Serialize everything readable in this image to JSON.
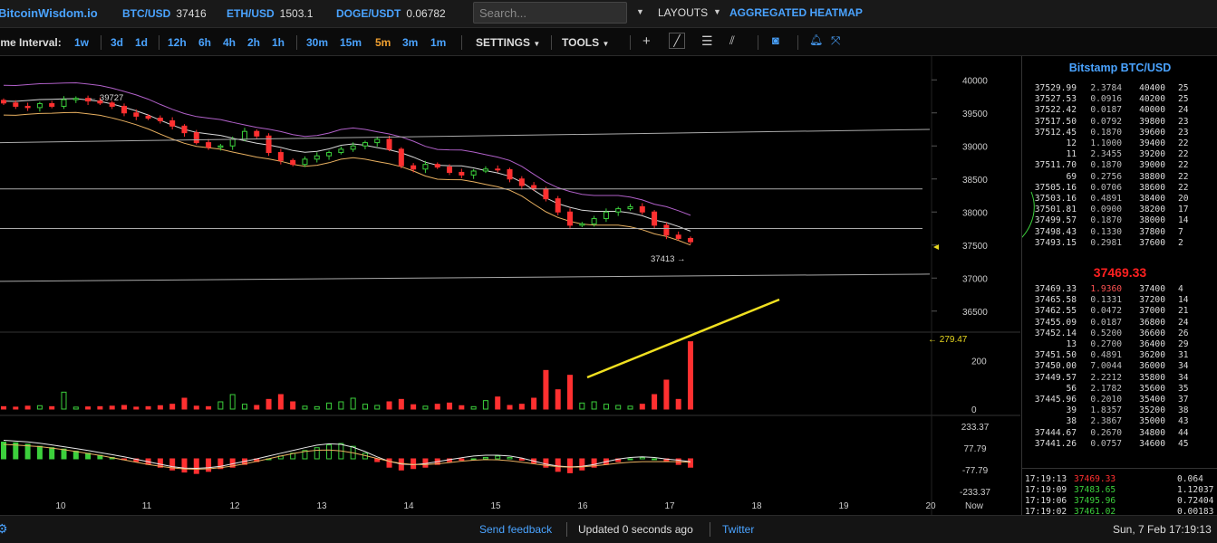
{
  "header": {
    "logo": "BitcoinWisdom.io",
    "tickers": [
      {
        "symbol": "BTC/USD",
        "value": "37416"
      },
      {
        "symbol": "ETH/USD",
        "value": "1503.1"
      },
      {
        "symbol": "DOGE/USDT",
        "value": "0.06782"
      }
    ],
    "search_placeholder": "Search...",
    "layouts_label": "LAYOUTS",
    "heatmap_label": "AGGREGATED HEATMAP"
  },
  "toolbar": {
    "interval_label": "ime Interval:",
    "intervals": [
      {
        "label": "1w",
        "active": false
      },
      {
        "label": "3d",
        "active": false
      },
      {
        "label": "1d",
        "active": false
      },
      {
        "label": "12h",
        "active": false
      },
      {
        "label": "6h",
        "active": false
      },
      {
        "label": "4h",
        "active": false
      },
      {
        "label": "2h",
        "active": false
      },
      {
        "label": "1h",
        "active": false
      },
      {
        "label": "30m",
        "active": false
      },
      {
        "label": "15m",
        "active": false
      },
      {
        "label": "5m",
        "active": true
      },
      {
        "label": "3m",
        "active": false
      },
      {
        "label": "1m",
        "active": false
      }
    ],
    "settings_label": "SETTINGS",
    "tools_label": "TOOLS",
    "icons": [
      "crosshair-icon",
      "line-tool-icon",
      "fib-tool-icon",
      "fan-tool-icon",
      "camera-icon",
      "bell-icon",
      "fullscreen-icon"
    ]
  },
  "chart_data": {
    "type": "candlestick",
    "price_axis": [
      "40000",
      "39500",
      "39000",
      "38500",
      "38000",
      "37500",
      "37000",
      "36500"
    ],
    "price_range": [
      36250,
      40250
    ],
    "high_label": "39727",
    "low_label": "37413",
    "x_labels": [
      "10",
      "11",
      "12",
      "13",
      "14",
      "15",
      "16",
      "17",
      "18",
      "19",
      "20",
      "Now"
    ],
    "volume_axis": [
      "200",
      "0"
    ],
    "volume_max_label": "279.47",
    "volume_range": [
      0,
      300
    ],
    "macd_axis": [
      "233.37",
      "77.79",
      "-77.79",
      "-233.37"
    ],
    "macd_range": [
      -260,
      260
    ],
    "close_series": [
      39650,
      39600,
      39580,
      39640,
      39600,
      39700,
      39720,
      39680,
      39650,
      39600,
      39500,
      39450,
      39420,
      39380,
      39300,
      39200,
      39050,
      38980,
      39000,
      39100,
      39220,
      39150,
      38900,
      38780,
      38720,
      38800,
      38850,
      38900,
      38950,
      39000,
      39050,
      39100,
      38950,
      38700,
      38650,
      38720,
      38680,
      38600,
      38560,
      38620,
      38650,
      38640,
      38500,
      38400,
      38350,
      38200,
      38000,
      37800,
      37820,
      37900,
      38000,
      38050,
      38080,
      38000,
      37800,
      37650,
      37600,
      37550
    ],
    "volume_series": [
      10,
      8,
      12,
      14,
      10,
      70,
      8,
      9,
      10,
      12,
      15,
      8,
      10,
      14,
      20,
      45,
      12,
      10,
      30,
      60,
      20,
      15,
      40,
      60,
      30,
      12,
      10,
      25,
      30,
      45,
      20,
      15,
      30,
      40,
      18,
      12,
      20,
      25,
      14,
      10,
      35,
      50,
      15,
      20,
      45,
      160,
      80,
      140,
      25,
      30,
      20,
      15,
      12,
      20,
      60,
      120,
      40,
      279
    ],
    "macd_series": [
      120,
      115,
      105,
      90,
      80,
      70,
      55,
      40,
      25,
      10,
      -5,
      -20,
      -40,
      -60,
      -80,
      -95,
      -105,
      -90,
      -70,
      -60,
      -40,
      -20,
      0,
      20,
      40,
      60,
      80,
      100,
      110,
      90,
      40,
      -20,
      -60,
      -80,
      -70,
      -60,
      -40,
      -20,
      -10,
      0,
      10,
      20,
      10,
      -10,
      -30,
      -60,
      -90,
      -100,
      -80,
      -60,
      -40,
      -20,
      0,
      10,
      0,
      -20,
      -40,
      -60
    ],
    "trend_lines": true,
    "bollinger_bands": true,
    "grid": false
  },
  "orderbook": {
    "title": "Bitstamp BTC/USD",
    "asks": [
      [
        "37529.99",
        "2.3784",
        "40400",
        "25"
      ],
      [
        "37527.53",
        "0.0916",
        "40200",
        "25"
      ],
      [
        "37522.42",
        "0.0187",
        "40000",
        "24"
      ],
      [
        "37517.50",
        "0.0792",
        "39800",
        "23"
      ],
      [
        "37512.45",
        "0.1870",
        "39600",
        "23"
      ],
      [
        "12",
        "1.1000",
        "39400",
        "22"
      ],
      [
        "11",
        "2.3455",
        "39200",
        "22"
      ],
      [
        "37511.70",
        "0.1870",
        "39000",
        "22"
      ],
      [
        "69",
        "0.2756",
        "38800",
        "22"
      ],
      [
        "37505.16",
        "0.0706",
        "38600",
        "22"
      ],
      [
        "37503.16",
        "0.4891",
        "38400",
        "20"
      ],
      [
        "37501.81",
        "0.0900",
        "38200",
        "17"
      ],
      [
        "37499.57",
        "0.1870",
        "38000",
        "14"
      ],
      [
        "37498.43",
        "0.1330",
        "37800",
        "7"
      ],
      [
        "37493.15",
        "0.2981",
        "37600",
        "2"
      ]
    ],
    "last_price": "37469.33",
    "bids": [
      [
        "37469.33",
        "1.9360",
        "37400",
        "4"
      ],
      [
        "37465.58",
        "0.1331",
        "37200",
        "14"
      ],
      [
        "37462.55",
        "0.0472",
        "37000",
        "21"
      ],
      [
        "37455.09",
        "0.0187",
        "36800",
        "24"
      ],
      [
        "37452.14",
        "0.5200",
        "36600",
        "26"
      ],
      [
        "13",
        "0.2700",
        "36400",
        "29"
      ],
      [
        "37451.50",
        "0.4891",
        "36200",
        "31"
      ],
      [
        "37450.00",
        "7.0044",
        "36000",
        "34"
      ],
      [
        "37449.57",
        "2.2212",
        "35800",
        "34"
      ],
      [
        "56",
        "2.1782",
        "35600",
        "35"
      ],
      [
        "37445.96",
        "0.2010",
        "35400",
        "37"
      ],
      [
        "39",
        "1.8357",
        "35200",
        "38"
      ],
      [
        "38",
        "2.3867",
        "35000",
        "43"
      ],
      [
        "37444.67",
        "0.2670",
        "34800",
        "44"
      ],
      [
        "37441.26",
        "0.0757",
        "34600",
        "45"
      ]
    ],
    "trades": [
      {
        "time": "17:19:13",
        "price": "37469.33",
        "amount": "0.064",
        "dir": "dn"
      },
      {
        "time": "17:19:09",
        "price": "37483.65",
        "amount": "1.12037",
        "dir": "up"
      },
      {
        "time": "17:19:06",
        "price": "37495.96",
        "amount": "0.72404",
        "dir": "up"
      },
      {
        "time": "17:19:02",
        "price": "37461.02",
        "amount": "0.00183",
        "dir": "up"
      }
    ]
  },
  "footer": {
    "feedback": "Send feedback",
    "updated": "Updated 0 seconds ago",
    "twitter": "Twitter",
    "datetime": "Sun, 7 Feb 17:19:13"
  }
}
